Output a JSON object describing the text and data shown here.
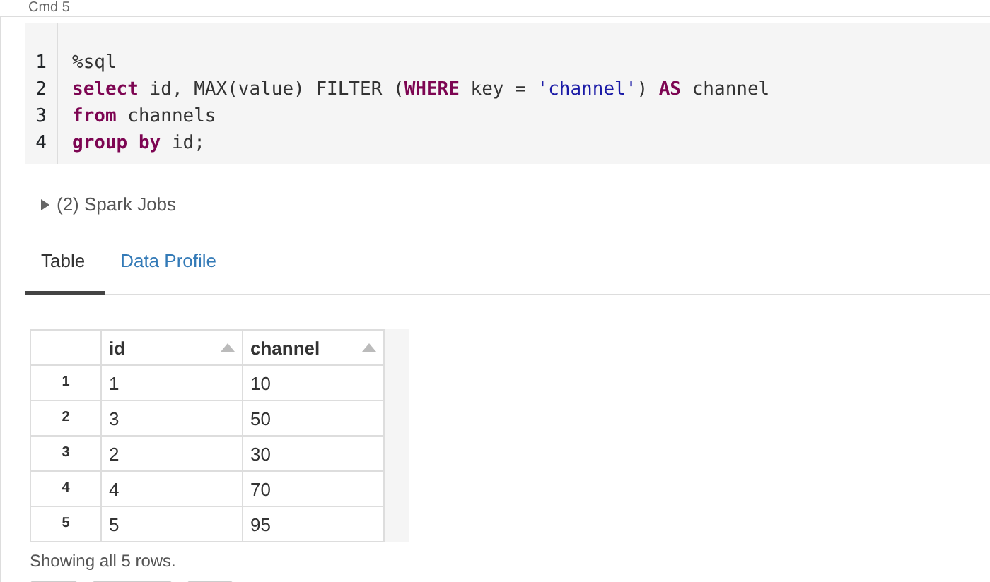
{
  "cell_label": "Cmd 5",
  "code": {
    "lines": [
      {
        "number": "1",
        "tokens": [
          {
            "kind": "plain",
            "text": "%sql"
          }
        ]
      },
      {
        "number": "2",
        "tokens": [
          {
            "kind": "keyword",
            "text": "select"
          },
          {
            "kind": "plain",
            "text": " id, MAX(value) FILTER ("
          },
          {
            "kind": "keyword",
            "text": "WHERE"
          },
          {
            "kind": "plain",
            "text": " key = "
          },
          {
            "kind": "string",
            "text": "'channel'"
          },
          {
            "kind": "plain",
            "text": ") "
          },
          {
            "kind": "keyword",
            "text": "AS"
          },
          {
            "kind": "plain",
            "text": " channel"
          }
        ]
      },
      {
        "number": "3",
        "tokens": [
          {
            "kind": "keyword",
            "text": "from"
          },
          {
            "kind": "plain",
            "text": " channels"
          }
        ]
      },
      {
        "number": "4",
        "tokens": [
          {
            "kind": "keyword",
            "text": "group by"
          },
          {
            "kind": "plain",
            "text": " id;"
          }
        ]
      }
    ]
  },
  "spark_jobs": {
    "label": "(2) Spark Jobs",
    "expanded": false
  },
  "tabs": [
    {
      "label": "Table",
      "selected": true
    },
    {
      "label": "Data Profile",
      "selected": false
    }
  ],
  "table": {
    "columns": [
      "id",
      "channel"
    ],
    "rows": [
      {
        "index": "1",
        "cells": [
          "1",
          "10"
        ]
      },
      {
        "index": "2",
        "cells": [
          "3",
          "50"
        ]
      },
      {
        "index": "3",
        "cells": [
          "2",
          "30"
        ]
      },
      {
        "index": "4",
        "cells": [
          "4",
          "70"
        ]
      },
      {
        "index": "5",
        "cells": [
          "5",
          "95"
        ]
      }
    ]
  },
  "footer": "Showing all 5 rows."
}
